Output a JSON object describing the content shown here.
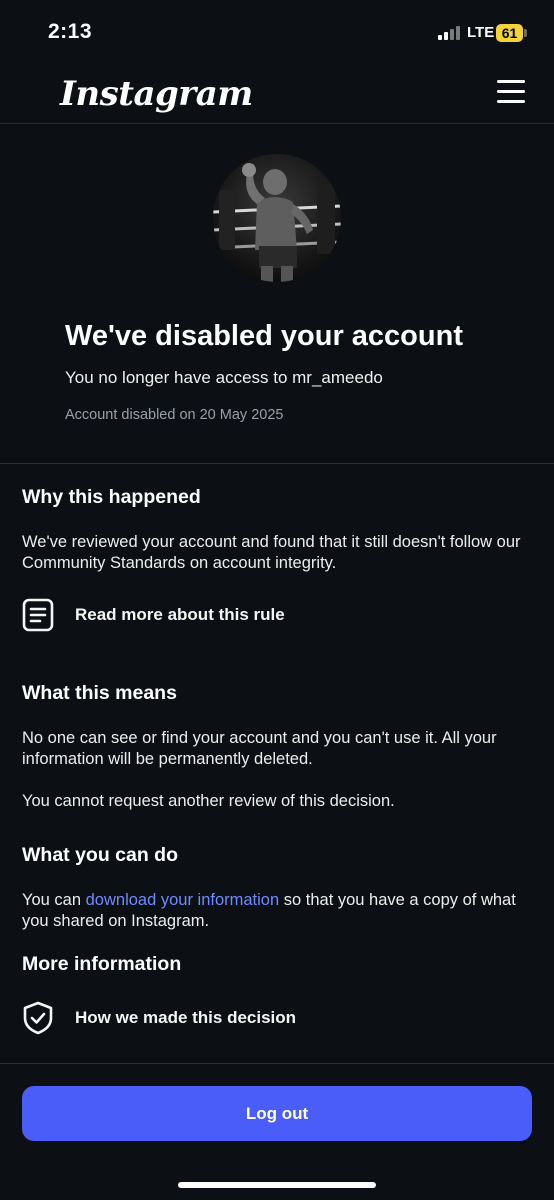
{
  "status_bar": {
    "time": "2:13",
    "network": "LTE",
    "battery": "61",
    "battery_color": "#f5d33a"
  },
  "header": {
    "logo": "Instagram",
    "menu_icon": "hamburger-menu-icon"
  },
  "profile": {
    "avatar_alt": "profile photo of boxer",
    "title": "We've disabled your account",
    "subtitle": "You no longer have access to mr_ameedo",
    "disabled_date": "Account disabled on 20 May 2025"
  },
  "why": {
    "heading": "Why this happened",
    "body": "We've reviewed your account and found that it still doesn't follow our Community Standards on account integrity.",
    "link_icon": "document-icon",
    "link_label": "Read more about this rule"
  },
  "means": {
    "heading": "What this means",
    "body1": "No one can see or find your account and you can't use it. All your information will be permanently deleted.",
    "body2": "You cannot request another review of this decision."
  },
  "can_do": {
    "heading": "What you can do",
    "body_prefix": "You can ",
    "link": "download your information",
    "body_suffix": " so that you have a copy of what you shared on Instagram."
  },
  "more_info": {
    "heading": "More information",
    "link_icon": "shield-check-icon",
    "link_label": "How we made this decision"
  },
  "footer": {
    "logout_label": "Log out",
    "accent_color": "#4a5df9",
    "link_color": "#6f8bff"
  }
}
